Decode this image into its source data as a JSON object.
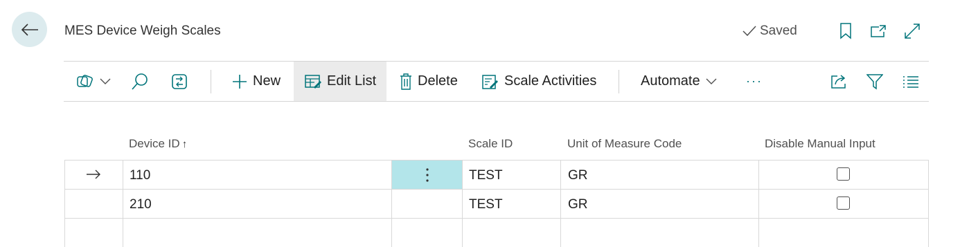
{
  "header": {
    "title": "MES Device Weigh Scales",
    "status": "Saved"
  },
  "toolbar": {
    "new_label": "New",
    "edit_list_label": "Edit List",
    "delete_label": "Delete",
    "scale_activities_label": "Scale Activities",
    "automate_label": "Automate",
    "more_label": "···"
  },
  "table": {
    "columns": [
      "Device ID",
      "Scale ID",
      "Unit of Measure Code",
      "Disable Manual Input"
    ],
    "sort_indicator": "↑",
    "rows": [
      {
        "device_id": "110",
        "scale_id": "TEST",
        "uom": "GR",
        "disable_manual_input": false,
        "selected": true
      },
      {
        "device_id": "210",
        "scale_id": "TEST",
        "uom": "GR",
        "disable_manual_input": false,
        "selected": false
      }
    ]
  },
  "colors": {
    "accent": "#00747a",
    "selected_cell": "#b3e5ea",
    "back_button_bg": "#dcebee"
  }
}
